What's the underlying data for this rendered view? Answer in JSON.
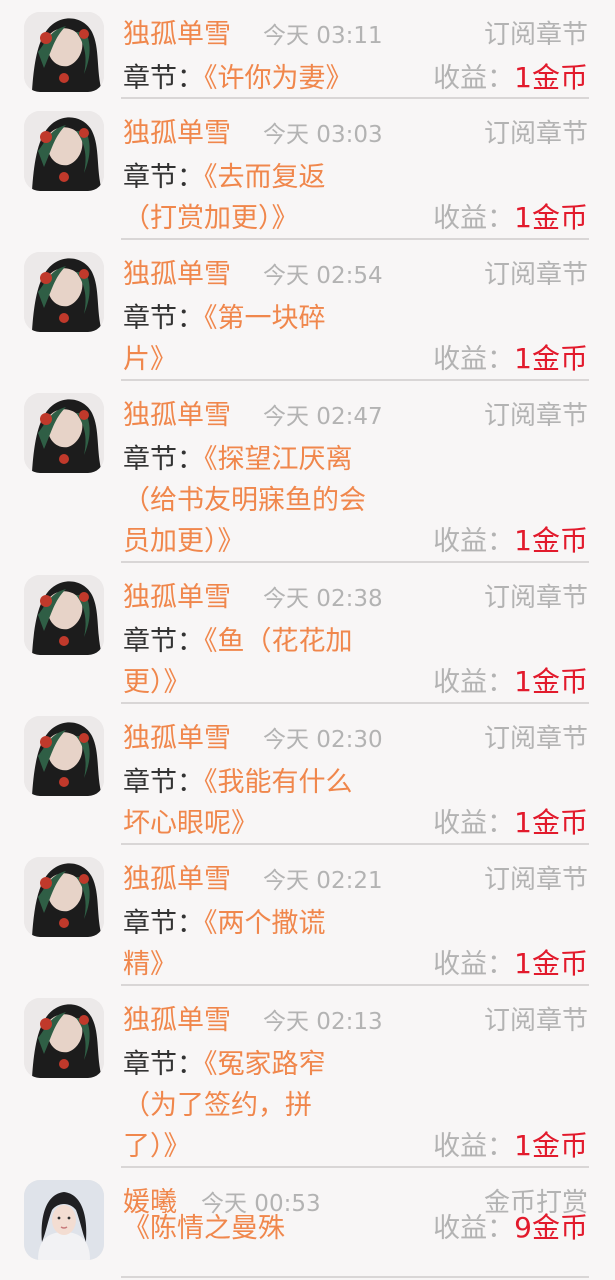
{
  "items": [
    {
      "name": "独孤单雪",
      "time": "今天 03:11",
      "type": "订阅章节",
      "prefix": "章节：",
      "chapter": "《许你为妻》",
      "income_label": "收益：",
      "income": "1金币"
    },
    {
      "name": "独孤单雪",
      "time": "今天 03:03",
      "type": "订阅章节",
      "prefix": "章节：",
      "chapter": "《去而复返\n（打赏加更）》",
      "income_label": "收益：",
      "income": "1金币"
    },
    {
      "name": "独孤单雪",
      "time": "今天 02:54",
      "type": "订阅章节",
      "prefix": "章节：",
      "chapter": "《第一块碎\n片》",
      "income_label": "收益：",
      "income": "1金币"
    },
    {
      "name": "独孤单雪",
      "time": "今天 02:47",
      "type": "订阅章节",
      "prefix": "章节：",
      "chapter": "《探望江厌离\n（给书友明寐鱼的会\n员加更）》",
      "income_label": "收益：",
      "income": "1金币"
    },
    {
      "name": "独孤单雪",
      "time": "今天 02:38",
      "type": "订阅章节",
      "prefix": "章节：",
      "chapter": "《鱼（花花加\n更）》",
      "income_label": "收益：",
      "income": "1金币"
    },
    {
      "name": "独孤单雪",
      "time": "今天 02:30",
      "type": "订阅章节",
      "prefix": "章节：",
      "chapter": "《我能有什么\n坏心眼呢》",
      "income_label": "收益：",
      "income": "1金币"
    },
    {
      "name": "独孤单雪",
      "time": "今天 02:21",
      "type": "订阅章节",
      "prefix": "章节：",
      "chapter": "《两个撒谎\n精》",
      "income_label": "收益：",
      "income": "1金币"
    },
    {
      "name": "独孤单雪",
      "time": "今天 02:13",
      "type": "订阅章节",
      "prefix": "章节：",
      "chapter": "《冤家路窄\n（为了签约，拼\n了）》",
      "income_label": "收益：",
      "income": "1金币"
    },
    {
      "name": "媛曦",
      "time": "今天 00:53",
      "type": "金币打赏",
      "prefix": "",
      "chapter": "《陈情之曼殊",
      "income_label": "收益：",
      "income": "9金币"
    }
  ]
}
